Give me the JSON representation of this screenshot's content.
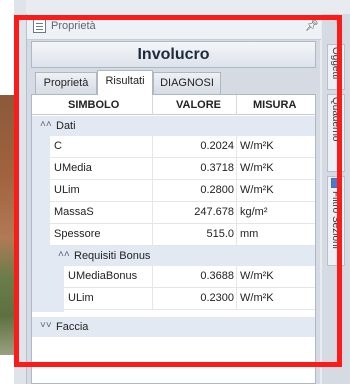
{
  "panel": {
    "title": "Proprietà",
    "pin_icon": "pin-icon"
  },
  "object_title": "Involucro",
  "tabs": [
    {
      "label": "Proprietà",
      "active": false
    },
    {
      "label": "Risultati",
      "active": true
    },
    {
      "label": "DIAGNOSI",
      "active": false
    }
  ],
  "grid": {
    "headers": {
      "symbol": "SIMBOLO",
      "value": "VALORE",
      "unit": "MISURA"
    },
    "groups": {
      "dati": "Dati",
      "requisiti": "Requisiti Bonus",
      "faccia": "Faccia"
    },
    "rows": [
      {
        "symbol": "C",
        "value": "0.2024",
        "unit": "W/m²K"
      },
      {
        "symbol": "UMedia",
        "value": "0.3718",
        "unit": "W/m²K"
      },
      {
        "symbol": "ULim",
        "value": "0.2800",
        "unit": "W/m²K"
      },
      {
        "symbol": "MassaS",
        "value": "247.678",
        "unit": "kg/m²"
      },
      {
        "symbol": "Spessore",
        "value": "515.0",
        "unit": "mm"
      }
    ],
    "bonus_rows": [
      {
        "symbol": "UMediaBonus",
        "value": "0.3688",
        "unit": "W/m²K"
      },
      {
        "symbol": "ULim",
        "value": "0.2300",
        "unit": "W/m²K"
      }
    ]
  },
  "right_strip": {
    "tabs": [
      "Oggetti",
      "Quaderno",
      "Filtro Sezioni"
    ]
  },
  "colors": {
    "highlight": "#ff1a1a",
    "group_bg": "#e3e9f2"
  }
}
